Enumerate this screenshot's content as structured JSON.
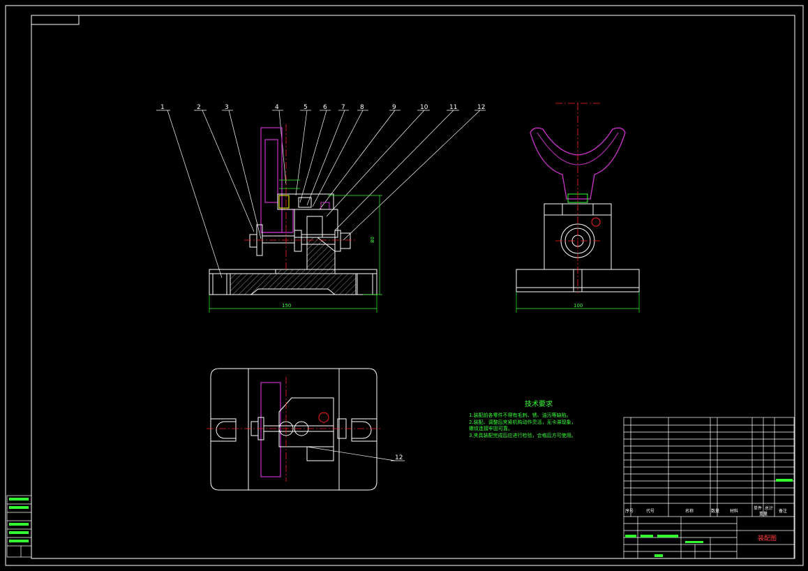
{
  "colors": {
    "outline": "#ffffff",
    "dimension": "#33ff33",
    "part_magenta": "#cc33cc",
    "centerline": "#ff2020",
    "hatch": "#cccccc"
  },
  "front_view": {
    "balloons": [
      "1",
      "2",
      "3",
      "4",
      "5",
      "6",
      "7",
      "8",
      "9",
      "10",
      "11",
      "12"
    ],
    "dim_width": "150",
    "dim_height": "80"
  },
  "side_view": {
    "dim_width": "100"
  },
  "top_view": {
    "section_label": "12"
  },
  "technical_requirements": {
    "title": "技术要求",
    "items": [
      "1.装配前各零件不得有毛刺、锈、油污等缺陷。",
      "2.装配、调整后夹紧机构动作灵活，无卡滞现象，",
      "   螺纹连接牢固可靠。",
      "3.夹具装配完成后应进行检验，合格后方可使用。"
    ]
  },
  "title_block": {
    "drawing_name": "装配图",
    "header": {
      "seq": "序号",
      "code": "代号",
      "name": "名称",
      "qty": "数量",
      "material": "材料",
      "weight_single": "单件",
      "weight_total": "总计",
      "weight": "重量",
      "remark": "备注"
    }
  }
}
